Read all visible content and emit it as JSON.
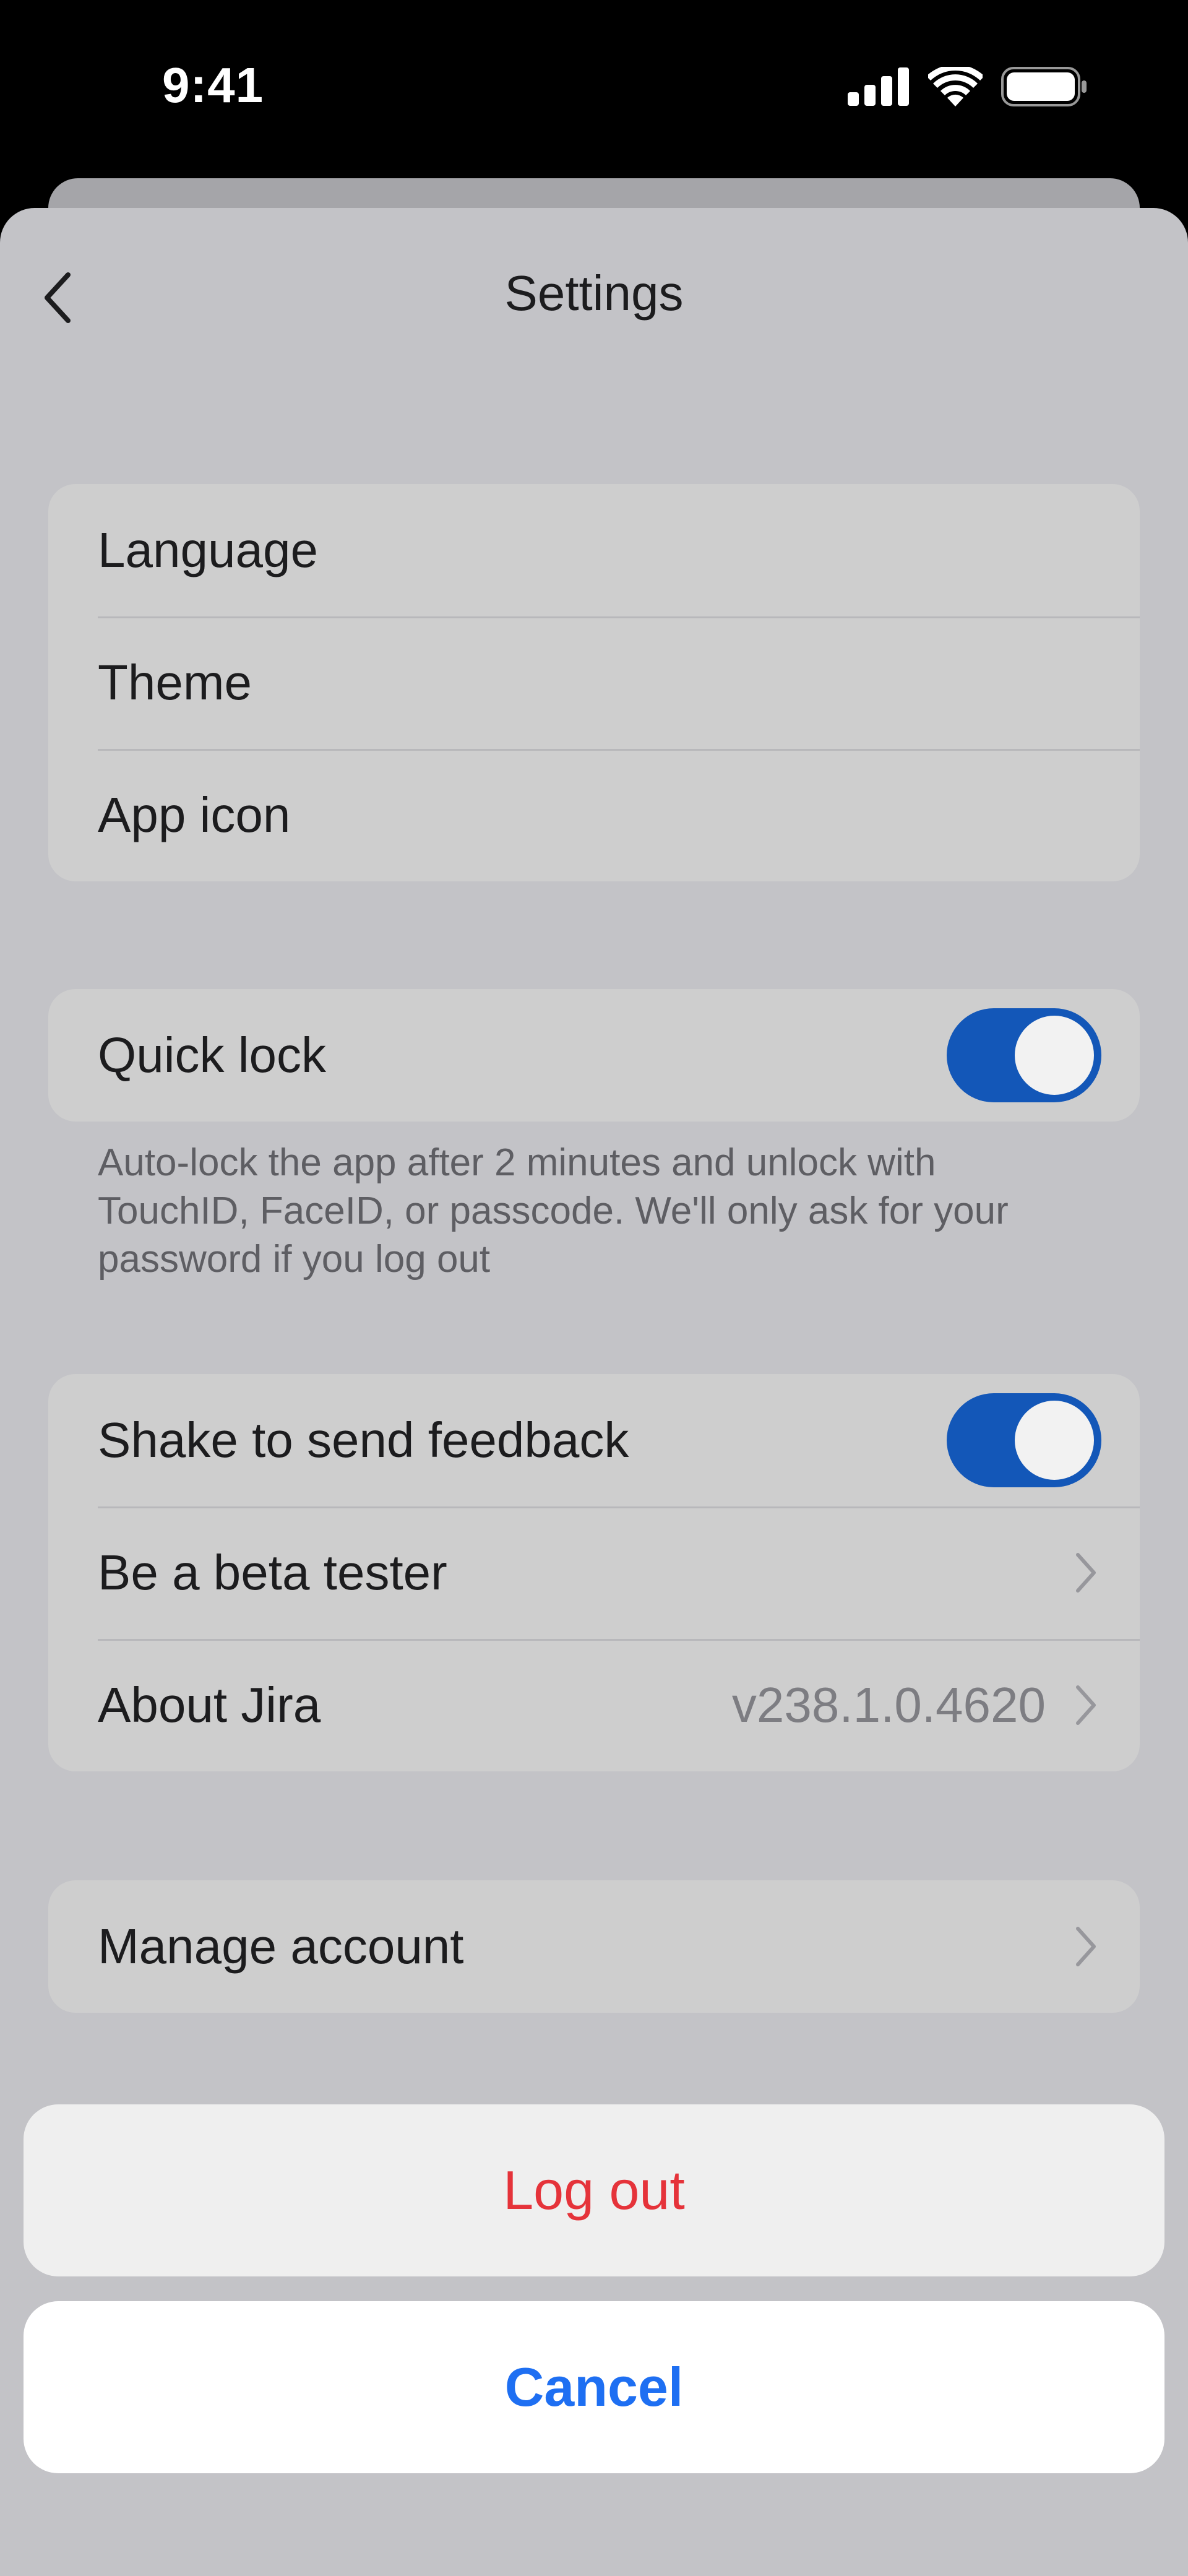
{
  "status_bar": {
    "time": "9:41",
    "icons": [
      "cellular-signal-icon",
      "wifi-icon",
      "battery-icon"
    ]
  },
  "nav": {
    "title": "Settings",
    "back_icon": "chevron-left-icon"
  },
  "groups": {
    "appearance": [
      {
        "label": "Language"
      },
      {
        "label": "Theme"
      },
      {
        "label": "App icon"
      }
    ],
    "security": {
      "quick_lock_label": "Quick lock",
      "quick_lock_on": true,
      "footnote": "Auto-lock the app after 2 minutes and unlock with TouchID, FaceID, or passcode. We'll only ask for your password if you log out"
    },
    "about": {
      "shake_label": "Shake to send feedback",
      "shake_on": true,
      "beta_label": "Be a beta tester",
      "about_label": "About Jira",
      "about_value": "v238.1.0.4620"
    },
    "account": {
      "manage_label": "Manage account"
    }
  },
  "action_sheet": {
    "logout_label": "Log out",
    "cancel_label": "Cancel"
  },
  "colors": {
    "toggle_on": "#1357b8",
    "destructive": "#e5333a",
    "accent": "#1e6ff2"
  }
}
